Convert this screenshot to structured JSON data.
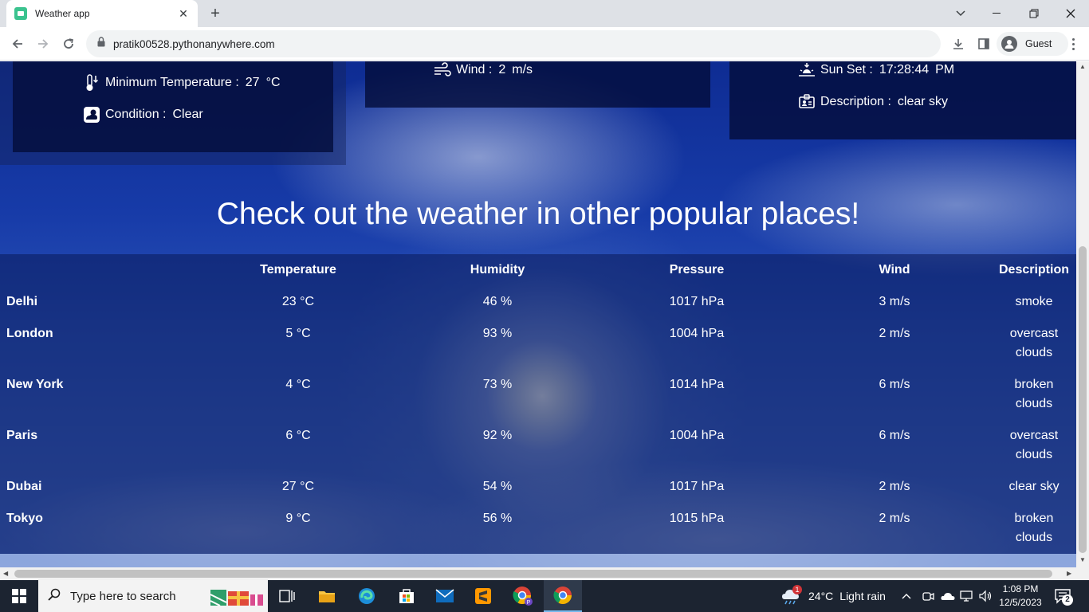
{
  "browser": {
    "tab_title": "Weather app",
    "tab_close": "✕",
    "new_tab": "+",
    "url": "pratik00528.pythonanywhere.com",
    "profile_label": "Guest"
  },
  "cards": {
    "min_temp_label": "Minimum Temperature :",
    "min_temp_value": "27",
    "min_temp_unit": "°C",
    "condition_label": "Condition :",
    "condition_value": "Clear",
    "wind_label": "Wind :",
    "wind_value": "2",
    "wind_unit": "m/s",
    "sunset_label": "Sun Set :",
    "sunset_value": "17:28:44",
    "sunset_ampm": "PM",
    "description_label": "Description :",
    "description_value": "clear sky"
  },
  "headline": "Check out the weather in other popular places!",
  "table": {
    "headers": [
      "Temperature",
      "Humidity",
      "Pressure",
      "Wind",
      "Description"
    ],
    "rows": [
      {
        "city": "Delhi",
        "temperature": "23 °C",
        "humidity": "46 %",
        "pressure": "1017 hPa",
        "wind": "3 m/s",
        "description": [
          "smoke"
        ]
      },
      {
        "city": "London",
        "temperature": "5 °C",
        "humidity": "93 %",
        "pressure": "1004 hPa",
        "wind": "2 m/s",
        "description": [
          "overcast",
          "clouds"
        ]
      },
      {
        "city": "New York",
        "temperature": "4 °C",
        "humidity": "73 %",
        "pressure": "1014 hPa",
        "wind": "6 m/s",
        "description": [
          "broken",
          "clouds"
        ]
      },
      {
        "city": "Paris",
        "temperature": "6 °C",
        "humidity": "92 %",
        "pressure": "1004 hPa",
        "wind": "6 m/s",
        "description": [
          "overcast",
          "clouds"
        ]
      },
      {
        "city": "Dubai",
        "temperature": "27 °C",
        "humidity": "54 %",
        "pressure": "1017 hPa",
        "wind": "2 m/s",
        "description": [
          "clear sky"
        ]
      },
      {
        "city": "Tokyo",
        "temperature": "9 °C",
        "humidity": "56 %",
        "pressure": "1015 hPa",
        "wind": "2 m/s",
        "description": [
          "broken",
          "clouds"
        ]
      }
    ]
  },
  "taskbar": {
    "search_placeholder": "Type here to search",
    "weather_temp": "24°C",
    "weather_text": "Light rain",
    "weather_badge": "1",
    "time": "1:08 PM",
    "date": "12/5/2023",
    "notification_count": "2"
  },
  "colors": {
    "accent_tab_favicon": "#3bc38f",
    "taskbar_bg": "#1c2431",
    "card_bg": "#040e3c"
  }
}
